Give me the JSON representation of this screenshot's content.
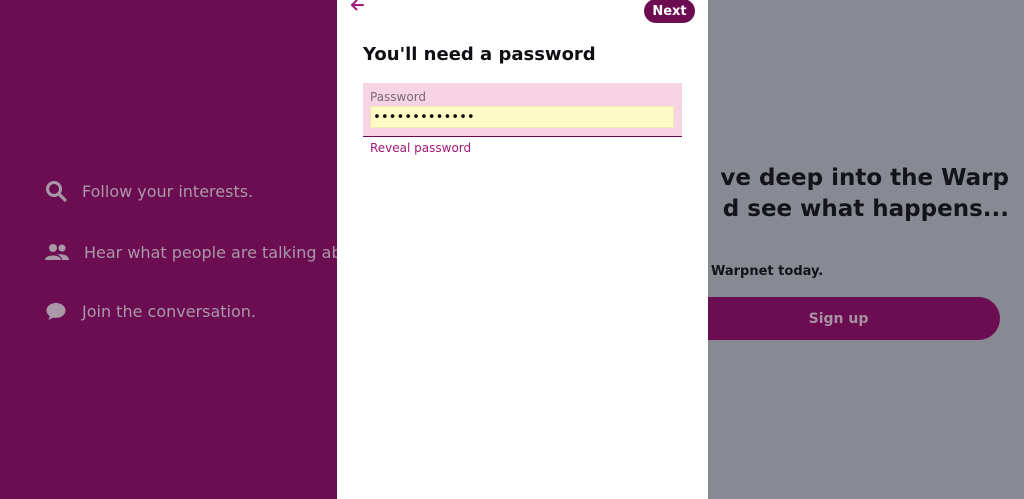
{
  "background_left": {
    "features": [
      {
        "icon": "search-icon",
        "text": "Follow your interests."
      },
      {
        "icon": "people-icon",
        "text": "Hear what people are talking abo"
      },
      {
        "icon": "chat-bubble-icon",
        "text": "Join the conversation."
      }
    ]
  },
  "background_right": {
    "hero_title_line1": "ve deep into the Warp",
    "hero_title_line2": "d see what happens...",
    "subtitle": "Warpnet today.",
    "signup_label": "Sign up"
  },
  "modal": {
    "back_icon": "arrow-left-icon",
    "next_label": "Next",
    "title": "You'll need a password",
    "password_label": "Password",
    "password_value": "•••••••••••••",
    "reveal_label": "Reveal password"
  },
  "colors": {
    "brand_purple": "#6c0d52",
    "overlay_grey": "#878a93",
    "link_pink": "#a3197c",
    "field_bg": "#f7d4e3",
    "autofill_yellow": "#fdfac5"
  }
}
